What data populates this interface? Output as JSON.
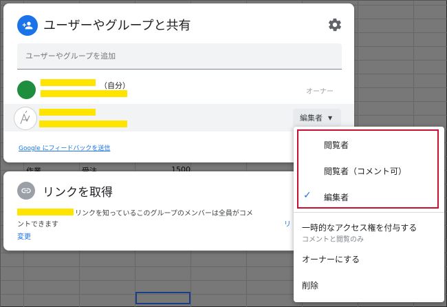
{
  "share": {
    "title": "ユーザーやグループと共有",
    "add_placeholder": "ユーザーやグループを追加",
    "self_label": "（自分）",
    "owner_label": "オーナー",
    "role_button_label": "編集者",
    "feedback_link": "Google にフィードバックを送信"
  },
  "link": {
    "title": "リンクを取得",
    "description_line1": "リンクを知っているこのグループのメンバーは全員がコメ",
    "description_line2": "ントできます",
    "change_label": "変更",
    "copy_partial": "リ"
  },
  "background": {
    "ghost_1": "作業",
    "ghost_2": "受注",
    "ghost_3": "1500"
  },
  "menu": {
    "roles": [
      {
        "label": "閲覧者",
        "checked": false
      },
      {
        "label": "閲覧者（コメント可）",
        "checked": false
      },
      {
        "label": "編集者",
        "checked": true
      }
    ],
    "check_glyph": "✓",
    "temp_access": "一時的なアクセス権を付与する",
    "temp_access_sub": "コメントと閲覧のみ",
    "make_owner": "オーナーにする",
    "remove": "削除"
  },
  "colors": {
    "accent": "#1a73e8",
    "highlight_border": "#c8102e",
    "redaction": "#ffe400",
    "avatar_green": "#1e8e3e"
  }
}
